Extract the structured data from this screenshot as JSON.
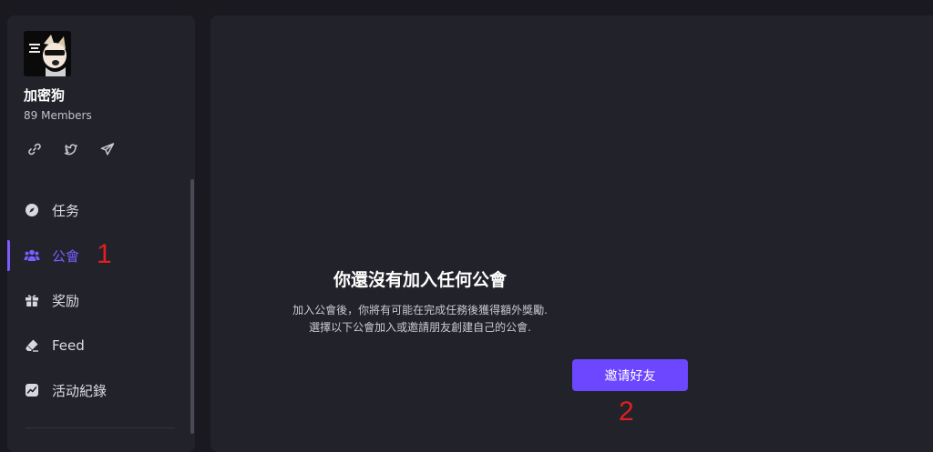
{
  "guild": {
    "name": "加密狗",
    "members": "89 Members"
  },
  "social": [
    "link-icon",
    "twitter-icon",
    "telegram-icon"
  ],
  "nav": {
    "items": [
      {
        "label": "任务",
        "icon": "compass-icon"
      },
      {
        "label": "公會",
        "icon": "people-icon",
        "active": true
      },
      {
        "label": "奖励",
        "icon": "gift-icon"
      },
      {
        "label": "Feed",
        "icon": "eraser-icon"
      },
      {
        "label": "活动紀錄",
        "icon": "chart-icon"
      }
    ]
  },
  "main": {
    "title": "你還沒有加入任何公會",
    "desc_line1": "加入公會後，你將有可能在完成任務後獲得額外獎勵.",
    "desc_line2": "選擇以下公會加入或邀請朋友創建自己的公會.",
    "invite_button": "邀请好友"
  },
  "annotations": {
    "first": "1",
    "second": "2"
  },
  "colors": {
    "accent": "#7b5cff",
    "button": "#6c47ff",
    "annotation": "#e02020",
    "panel": "#22222b",
    "background": "#19191f"
  }
}
